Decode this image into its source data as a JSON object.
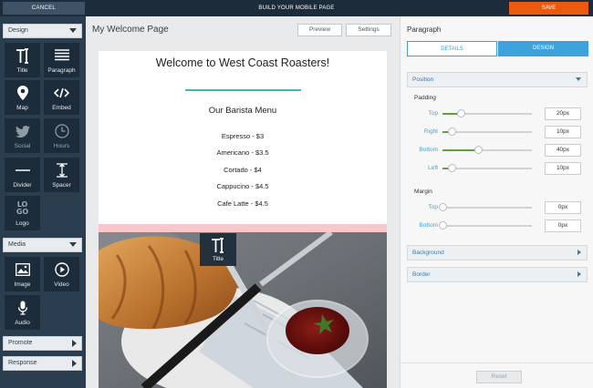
{
  "topbar": {
    "cancel_label": "CANCEL",
    "title": "BUILD YOUR MOBILE PAGE",
    "save_label": "SAVE"
  },
  "sidebar": {
    "design_label": "Design",
    "design_tiles": [
      {
        "label": "Title",
        "icon": "title-icon"
      },
      {
        "label": "Paragraph",
        "icon": "paragraph-icon"
      },
      {
        "label": "Map",
        "icon": "map-pin-icon"
      },
      {
        "label": "Embed",
        "icon": "code-icon"
      },
      {
        "label": "Social",
        "icon": "twitter-icon"
      },
      {
        "label": "Hours",
        "icon": "clock-icon"
      },
      {
        "label": "Divider",
        "icon": "divider-icon"
      },
      {
        "label": "Spacer",
        "icon": "spacer-icon"
      },
      {
        "label": "Logo",
        "icon": "logo-icon"
      }
    ],
    "logo_tile_text": [
      "LO",
      "GO"
    ],
    "media_label": "Media",
    "media_tiles": [
      {
        "label": "Image",
        "icon": "image-icon"
      },
      {
        "label": "Video",
        "icon": "play-icon"
      },
      {
        "label": "Audio",
        "icon": "microphone-icon"
      }
    ],
    "promote_label": "Promote",
    "response_label": "Response"
  },
  "canvas": {
    "page_title": "My Welcome Page",
    "preview_label": "Preview",
    "settings_label": "Settings",
    "welcome_heading": "Welcome to West Coast Roasters!",
    "menu_title": "Our Barista Menu",
    "menu_items": [
      "Espresso - $3",
      "Americano - $3.5",
      "Cortado - $4",
      "Cappucino - $4.5",
      "Cafe Latte - $4.5"
    ],
    "drag_tile_label": "Title",
    "accent_color": "#3fbcb0"
  },
  "panel": {
    "title": "Paragraph",
    "tab_details": "DETAILS",
    "tab_design": "DESIGN",
    "position_label": "Position",
    "padding_label": "Padding",
    "padding": [
      {
        "label": "Top",
        "value": "20px",
        "fraction": 0.2
      },
      {
        "label": "Right",
        "value": "10px",
        "fraction": 0.1
      },
      {
        "label": "Bottom",
        "value": "40px",
        "fraction": 0.4
      },
      {
        "label": "Left",
        "value": "10px",
        "fraction": 0.1
      }
    ],
    "margin_label": "Margin",
    "margin": [
      {
        "label": "Top",
        "value": "0px",
        "fraction": 0
      },
      {
        "label": "Bottom",
        "value": "0px",
        "fraction": 0
      }
    ],
    "background_label": "Background",
    "border_label": "Border",
    "reset_label": "Reset"
  },
  "colors": {
    "brand_dark": "#1d2c3b",
    "save_orange": "#ee5a0d",
    "design_blue": "#3ea3dd",
    "slider_green": "#5ba43a"
  }
}
